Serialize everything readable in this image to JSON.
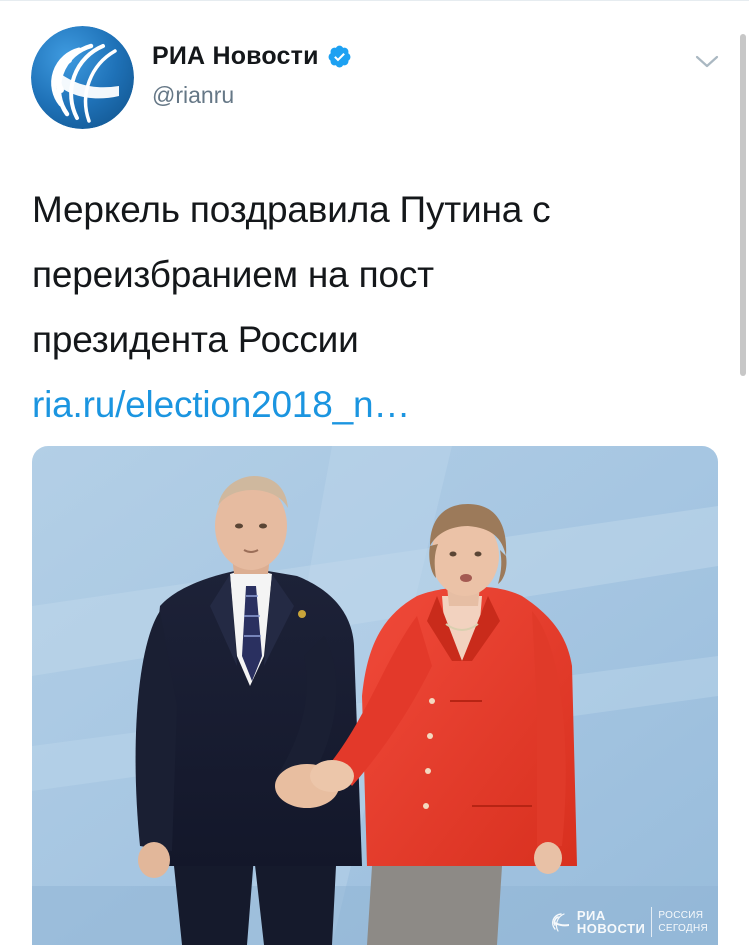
{
  "tweet": {
    "author": {
      "display_name": "РИА Новости",
      "handle": "@rianru",
      "verified": true,
      "avatar_icon": "ria-logo-icon",
      "brand_color": "#1f72b8"
    },
    "menu_icon": "chevron-down-icon",
    "text_lines": [
      "Меркель поздравила Путина с",
      "переизбранием на пост",
      "президента России"
    ],
    "link_text": "ria.ru/election2018_n…",
    "link_color": "#1b95e0",
    "media": {
      "watermark": {
        "ria_line1": "РИА",
        "ria_line2": "НОВОСТИ",
        "rs_line1": "РОССИЯ",
        "rs_line2": "СЕГОДНЯ"
      }
    }
  }
}
